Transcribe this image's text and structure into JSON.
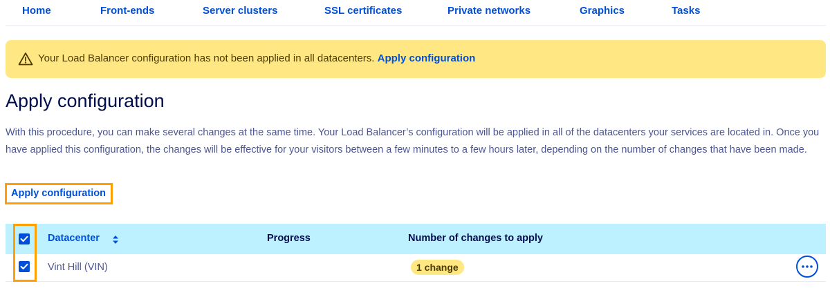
{
  "tabs": [
    {
      "label": "Home"
    },
    {
      "label": "Front-ends"
    },
    {
      "label": "Server clusters"
    },
    {
      "label": "SSL certificates"
    },
    {
      "label": "Private networks"
    },
    {
      "label": "Graphics"
    },
    {
      "label": "Tasks"
    }
  ],
  "alert": {
    "message": "Your Load Balancer configuration has not been applied in all datacenters.",
    "link_label": "Apply configuration",
    "icon": "warning-icon"
  },
  "page": {
    "title": "Apply configuration",
    "description": "With this procedure, you can make several changes at the same time. Your Load Balancer’s configuration will be applied in all of the datacenters your services are located in. Once you have applied this configuration, the changes will be effective for your visitors between a few minutes to a few hours later, depending on the number of changes that have been made.",
    "apply_button_label": "Apply configuration"
  },
  "table": {
    "columns": {
      "datacenter": "Datacenter",
      "progress": "Progress",
      "changes": "Number of changes to apply"
    },
    "select_all_checked": true,
    "rows": [
      {
        "checked": true,
        "datacenter": "Vint Hill (VIN)",
        "progress": "",
        "changes": "1 change",
        "actions_icon": "more-horizontal-icon"
      }
    ]
  },
  "colors": {
    "link": "#0050d7",
    "alert_background": "#ffe883",
    "table_header_background": "#bef1ff",
    "highlight": "#ffa000",
    "title": "#000d4d"
  }
}
